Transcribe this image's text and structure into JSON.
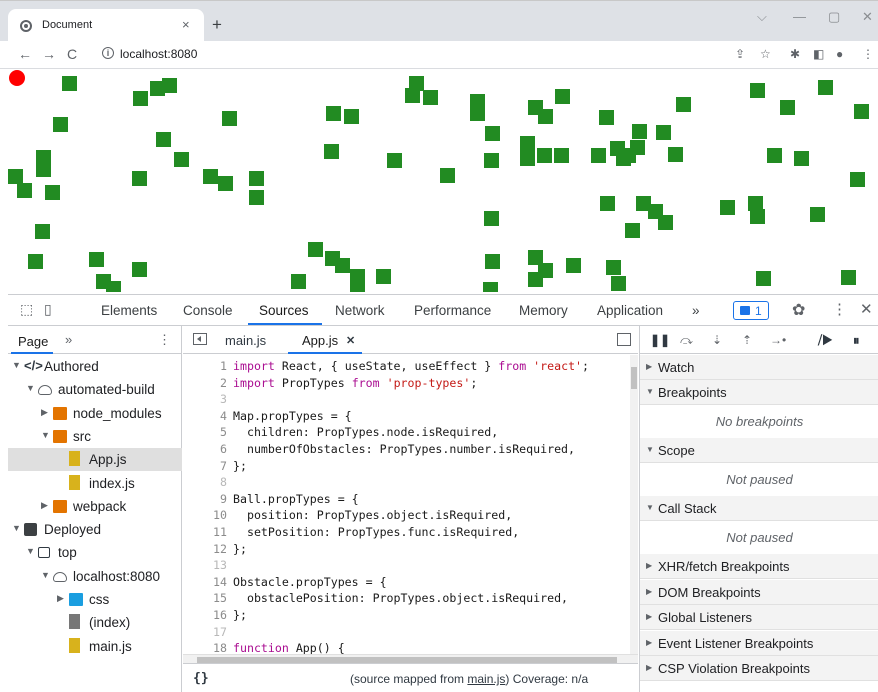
{
  "browser": {
    "tab_title": "Document",
    "tab_close": "×",
    "new_tab": "+",
    "url": "localhost:8080",
    "minimize": "—",
    "maximize": "▢",
    "close": "✕",
    "chevron": "⌵"
  },
  "devtools": {
    "tabs": [
      "Elements",
      "Console",
      "Sources",
      "Network",
      "Performance",
      "Memory",
      "Application"
    ],
    "more_tabs": "»",
    "issues_count": "1",
    "navigator": {
      "tab": "Page",
      "more": "»",
      "tree": [
        {
          "label": "Authored"
        },
        {
          "label": "automated-build"
        },
        {
          "label": "node_modules"
        },
        {
          "label": "src"
        },
        {
          "label": "App.js"
        },
        {
          "label": "index.js"
        },
        {
          "label": "webpack"
        },
        {
          "label": "Deployed"
        },
        {
          "label": "top"
        },
        {
          "label": "localhost:8080"
        },
        {
          "label": "css"
        },
        {
          "label": "(index)"
        },
        {
          "label": "main.js"
        }
      ]
    },
    "editor": {
      "tabs": [
        {
          "label": "main.js"
        },
        {
          "label": "App.js"
        }
      ],
      "tab_close": "✕",
      "footer_braces": "{}",
      "footer_prefix": "(source mapped from ",
      "footer_link": "main.js",
      "footer_suffix": ")  Coverage: n/a",
      "lines": [
        {
          "n": "1",
          "code": [
            [
              "kw",
              "import"
            ],
            [
              "",
              "React, { useState, useEffect } "
            ],
            [
              "kw",
              "from"
            ],
            [
              "",
              " "
            ],
            [
              "str",
              "'react'"
            ],
            [
              "",
              ";"
            ]
          ]
        },
        {
          "n": "2",
          "code": [
            [
              "kw",
              "import"
            ],
            [
              "",
              "PropTypes "
            ],
            [
              "kw",
              "from"
            ],
            [
              "",
              " "
            ],
            [
              "str",
              "'prop-types'"
            ],
            [
              "",
              ";"
            ]
          ]
        },
        {
          "n": "3",
          "code": []
        },
        {
          "n": "4",
          "code": [
            [
              "",
              "Map.propTypes = {"
            ]
          ]
        },
        {
          "n": "5",
          "code": [
            [
              "",
              "  children: PropTypes.node.isRequired,"
            ]
          ]
        },
        {
          "n": "6",
          "code": [
            [
              "",
              "  numberOfObstacles: PropTypes.number.isRequired,"
            ]
          ]
        },
        {
          "n": "7",
          "code": [
            [
              "",
              "};"
            ]
          ]
        },
        {
          "n": "8",
          "code": []
        },
        {
          "n": "9",
          "code": [
            [
              "",
              "Ball.propTypes = {"
            ]
          ]
        },
        {
          "n": "10",
          "code": [
            [
              "",
              "  position: PropTypes.object.isRequired,"
            ]
          ]
        },
        {
          "n": "11",
          "code": [
            [
              "",
              "  setPosition: PropTypes.func.isRequired,"
            ]
          ]
        },
        {
          "n": "12",
          "code": [
            [
              "",
              "};"
            ]
          ]
        },
        {
          "n": "13",
          "code": []
        },
        {
          "n": "14",
          "code": [
            [
              "",
              "Obstacle.propTypes = {"
            ]
          ]
        },
        {
          "n": "15",
          "code": [
            [
              "",
              "  obstaclePosition: PropTypes.object.isRequired,"
            ]
          ]
        },
        {
          "n": "16",
          "code": [
            [
              "",
              "};"
            ]
          ]
        },
        {
          "n": "17",
          "code": []
        },
        {
          "n": "18",
          "code": [
            [
              "kw",
              "function"
            ],
            [
              "",
              " App() {"
            ]
          ]
        }
      ]
    },
    "debugger": {
      "sections": [
        {
          "label": "Watch",
          "open": false
        },
        {
          "label": "Breakpoints",
          "open": true,
          "empty": "No breakpoints"
        },
        {
          "label": "Scope",
          "open": true,
          "empty": "Not paused"
        },
        {
          "label": "Call Stack",
          "open": true,
          "empty": "Not paused"
        },
        {
          "label": "XHR/fetch Breakpoints",
          "open": false
        },
        {
          "label": "DOM Breakpoints",
          "open": false
        },
        {
          "label": "Global Listeners",
          "open": false
        },
        {
          "label": "Event Listener Breakpoints",
          "open": false
        },
        {
          "label": "CSP Violation Breakpoints",
          "open": false
        }
      ]
    }
  },
  "colors": {
    "obstacle": "#228b22",
    "ball": "#ff0000",
    "accent": "#1a73e8"
  }
}
